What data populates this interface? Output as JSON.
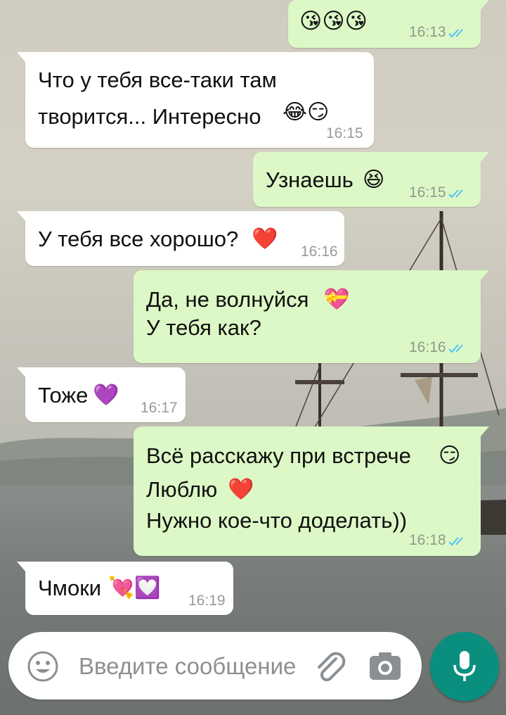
{
  "colors": {
    "incoming_bubble": "#ffffff",
    "outgoing_bubble": "#dcf8c6",
    "read_ticks": "#4fc3f7",
    "mic_button": "#0a8f7f"
  },
  "messages": [
    {
      "dir": "out",
      "text": "",
      "emoji": "😘😘😘",
      "time": "16:13",
      "status": "read"
    },
    {
      "dir": "in",
      "text": "Что у тебя все-таки там\nтворится... Интересно",
      "emoji": "😂😏",
      "time": "16:15"
    },
    {
      "dir": "out",
      "text": "Узнаешь",
      "emoji": "😆",
      "time": "16:15",
      "status": "read"
    },
    {
      "dir": "in",
      "text": "У тебя все хорошо?",
      "emoji": "❤️",
      "time": "16:16"
    },
    {
      "dir": "out",
      "text": "Да, не волнуйся",
      "emoji": "💝",
      "text2": "У тебя как?",
      "time": "16:16",
      "status": "read"
    },
    {
      "dir": "in",
      "text": "Тоже",
      "emoji": "💜",
      "time": "16:17"
    },
    {
      "dir": "out",
      "text": "Всё расскажу при встрече",
      "emoji": "😏",
      "text2": "Люблю",
      "emoji2": "❤️",
      "text3": "Нужно кое-что доделать))",
      "time": "16:18",
      "status": "read"
    },
    {
      "dir": "in",
      "text": "Чмоки",
      "emoji": "💘💟",
      "time": "16:19"
    }
  ],
  "composer": {
    "placeholder": "Введите сообщение",
    "emoji_icon": "smiley-icon",
    "attach_icon": "paperclip-icon",
    "camera_icon": "camera-icon",
    "mic_icon": "microphone-icon"
  }
}
